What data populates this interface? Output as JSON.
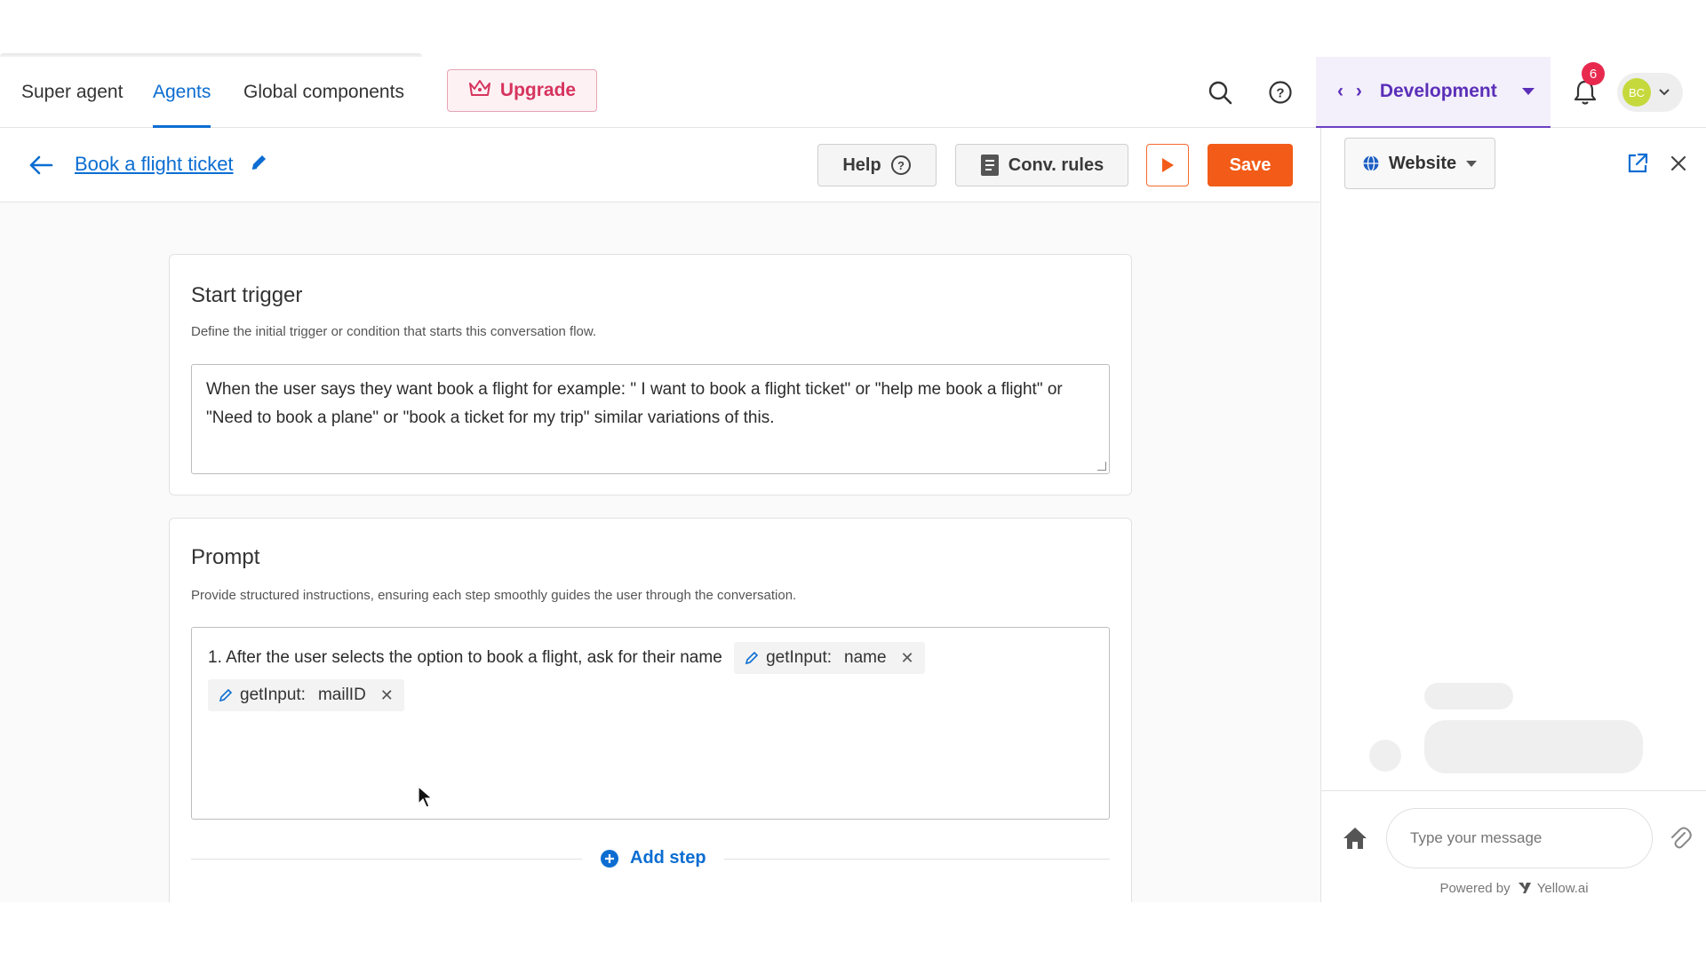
{
  "nav": {
    "tabs": [
      "Super agent",
      "Agents",
      "Global components"
    ],
    "upgrade_label": "Upgrade",
    "environment_label": "Development",
    "notification_count": "6",
    "avatar_initials": "BC"
  },
  "subheader": {
    "title": "Book a flight ticket",
    "help_label": "Help",
    "conv_rules_label": "Conv. rules",
    "save_label": "Save"
  },
  "start_trigger": {
    "title": "Start trigger",
    "description": "Define the initial trigger or condition that starts this conversation flow.",
    "text": "When the user says they want book a flight for example:  \" I want to book a flight ticket\" or \"help me book a flight\" or \"Need to book a plane\"  or \"book a ticket for my trip\" similar variations of this."
  },
  "prompt": {
    "title": "Prompt",
    "description": "Provide structured instructions, ensuring each step smoothly guides the user through the conversation.",
    "step_text": "1. After the user selects the option to book a flight, ask for their name",
    "chips": [
      {
        "fn": "getInput:",
        "value": "name"
      },
      {
        "fn": "getInput:",
        "value": "mailID"
      }
    ],
    "add_step_label": "Add step"
  },
  "preview": {
    "channel_label": "Website",
    "input_placeholder": "Type your message",
    "powered_by": "Powered by",
    "brand": "Yellow.ai"
  },
  "colors": {
    "accent_blue": "#0b6dd1",
    "save_orange": "#f25c18",
    "upgrade_pink": "#d6345e",
    "env_purple": "#5b2fb8"
  }
}
